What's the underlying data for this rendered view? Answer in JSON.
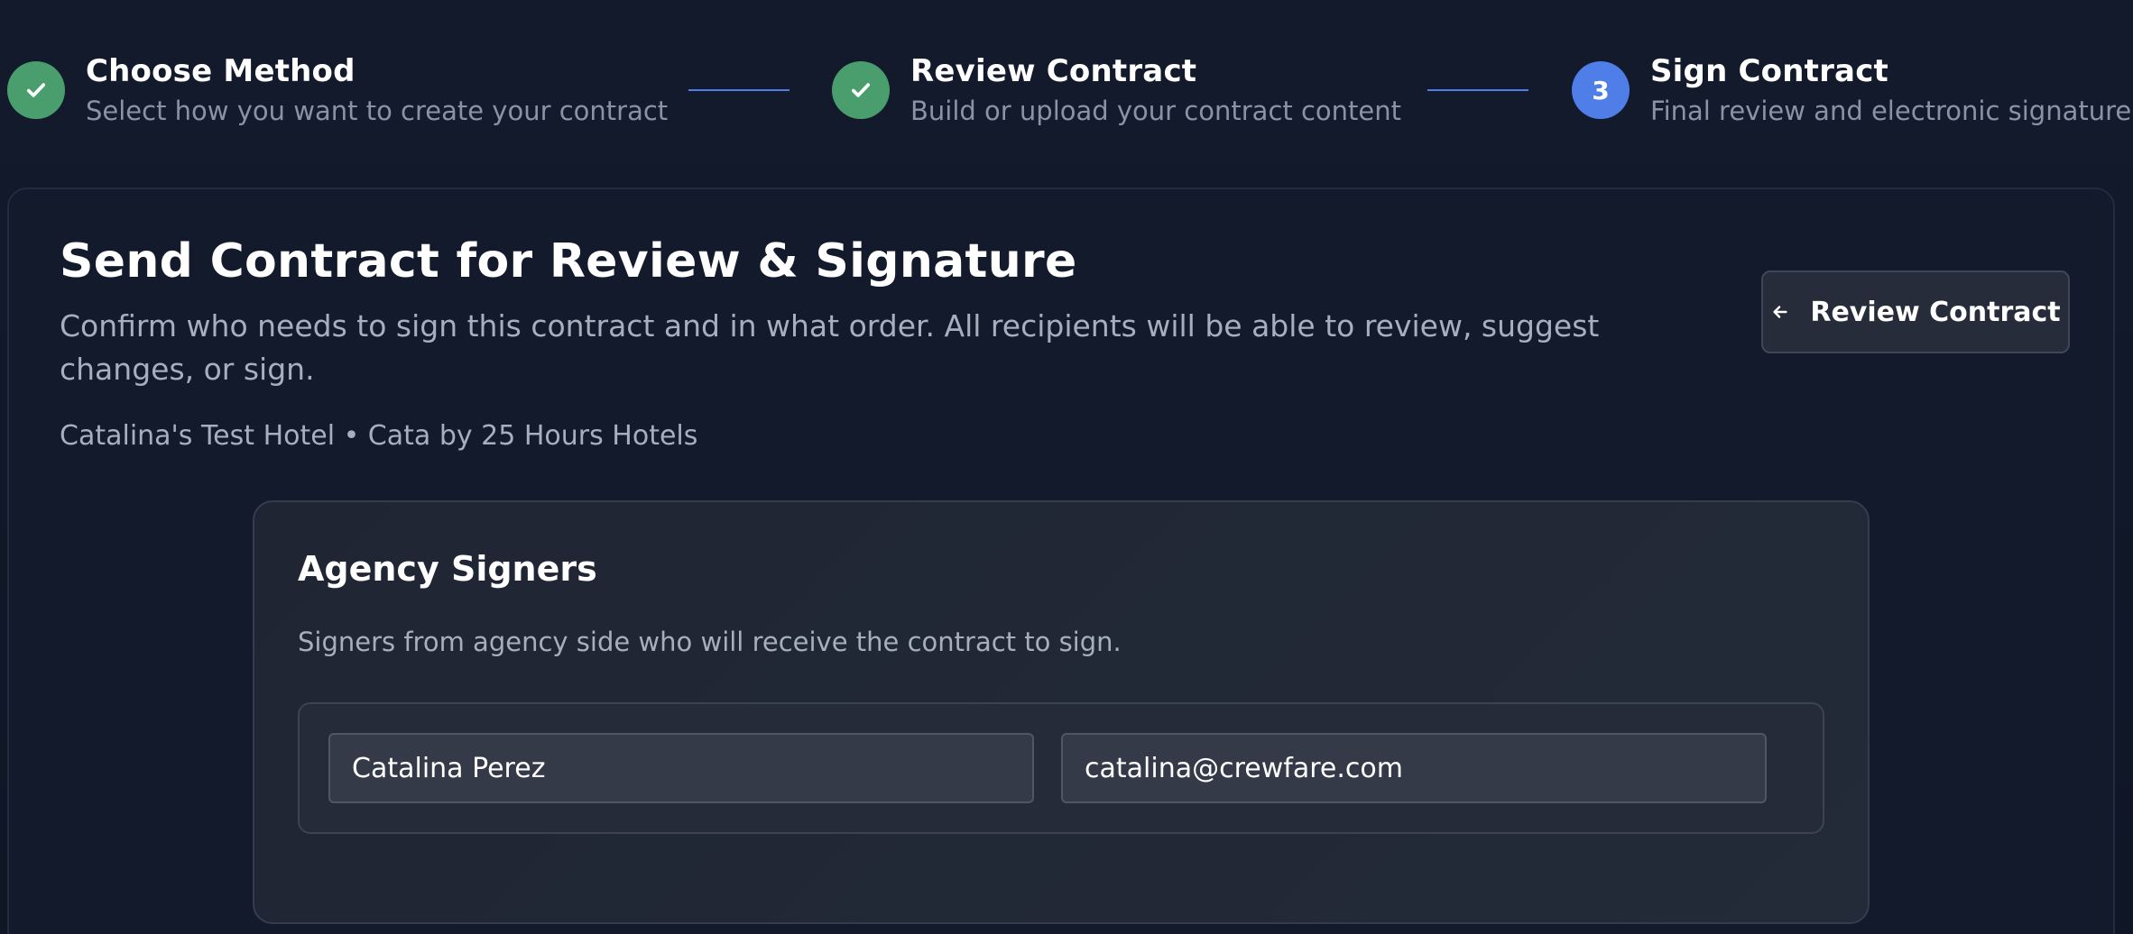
{
  "stepper": {
    "steps": [
      {
        "title": "Choose Method",
        "subtitle": "Select how you want to create your contract",
        "status": "done"
      },
      {
        "title": "Review Contract",
        "subtitle": "Build or upload your contract content",
        "status": "done"
      },
      {
        "number": "3",
        "title": "Sign Contract",
        "subtitle": "Final review and electronic signature",
        "status": "active"
      }
    ]
  },
  "main": {
    "title": "Send Contract for Review & Signature",
    "description": "Confirm who needs to sign this contract and in what order. All recipients will be able to review, suggest changes, or sign.",
    "hotel_line": "Catalina's Test Hotel • Cata by 25 Hours Hotels",
    "back_button_label": "Review Contract",
    "back_button_icon": "arrow-left-icon"
  },
  "agency_signers": {
    "title": "Agency Signers",
    "description": "Signers from agency side who will receive the contract to sign.",
    "signers": [
      {
        "name": "Catalina Perez",
        "email": "catalina@crewfare.com"
      }
    ]
  },
  "colors": {
    "done": "#4a9e6e",
    "active": "#4f7ee8",
    "background": "#111827"
  }
}
